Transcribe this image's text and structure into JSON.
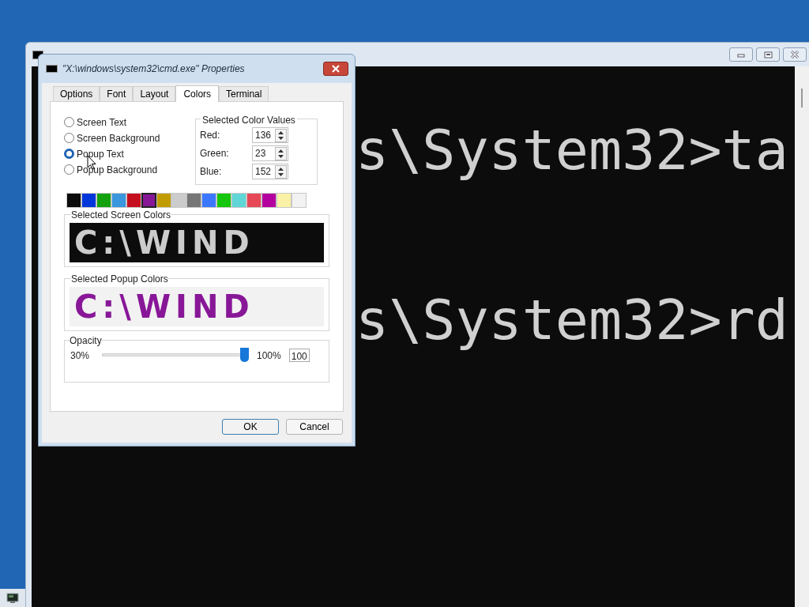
{
  "console": {
    "lines": [
      "s\\System32>ta",
      "s\\System32>rd"
    ]
  },
  "dialog": {
    "title": "\"X:\\windows\\system32\\cmd.exe\" Properties",
    "tabs": [
      {
        "label": "Options",
        "selected": false
      },
      {
        "label": "Font",
        "selected": false
      },
      {
        "label": "Layout",
        "selected": false
      },
      {
        "label": "Colors",
        "selected": true
      },
      {
        "label": "Terminal",
        "selected": false
      }
    ],
    "targets": [
      {
        "label": "Screen Text",
        "selected": false
      },
      {
        "label": "Screen Background",
        "selected": false
      },
      {
        "label": "Popup Text",
        "selected": true
      },
      {
        "label": "Popup Background",
        "selected": false
      }
    ],
    "color_values": {
      "title": "Selected Color Values",
      "fields": [
        {
          "label": "Red:",
          "value": "136"
        },
        {
          "label": "Green:",
          "value": "23"
        },
        {
          "label": "Blue:",
          "value": "152"
        }
      ]
    },
    "palette": [
      {
        "color": "#0c0c0c",
        "selected": false
      },
      {
        "color": "#0037da",
        "selected": false
      },
      {
        "color": "#13a10e",
        "selected": false
      },
      {
        "color": "#3a96dd",
        "selected": false
      },
      {
        "color": "#c50f1f",
        "selected": false
      },
      {
        "color": "#881798",
        "selected": true
      },
      {
        "color": "#c19c00",
        "selected": false
      },
      {
        "color": "#cccccc",
        "selected": false
      },
      {
        "color": "#767676",
        "selected": false
      },
      {
        "color": "#3b78ff",
        "selected": false
      },
      {
        "color": "#16c60c",
        "selected": false
      },
      {
        "color": "#61d6d6",
        "selected": false
      },
      {
        "color": "#e74856",
        "selected": false
      },
      {
        "color": "#b4009e",
        "selected": false
      },
      {
        "color": "#f9f1a5",
        "selected": false
      },
      {
        "color": "#f2f2f2",
        "selected": false
      }
    ],
    "screen_preview": {
      "title": "Selected Screen Colors",
      "text": "C:\\WIND"
    },
    "popup_preview": {
      "title": "Selected Popup Colors",
      "text": "C:\\WIND"
    },
    "opacity": {
      "title": "Opacity",
      "min_label": "30%",
      "max_label": "100%",
      "level": 1,
      "value": "100"
    },
    "buttons": [
      "OK",
      "Cancel"
    ]
  }
}
